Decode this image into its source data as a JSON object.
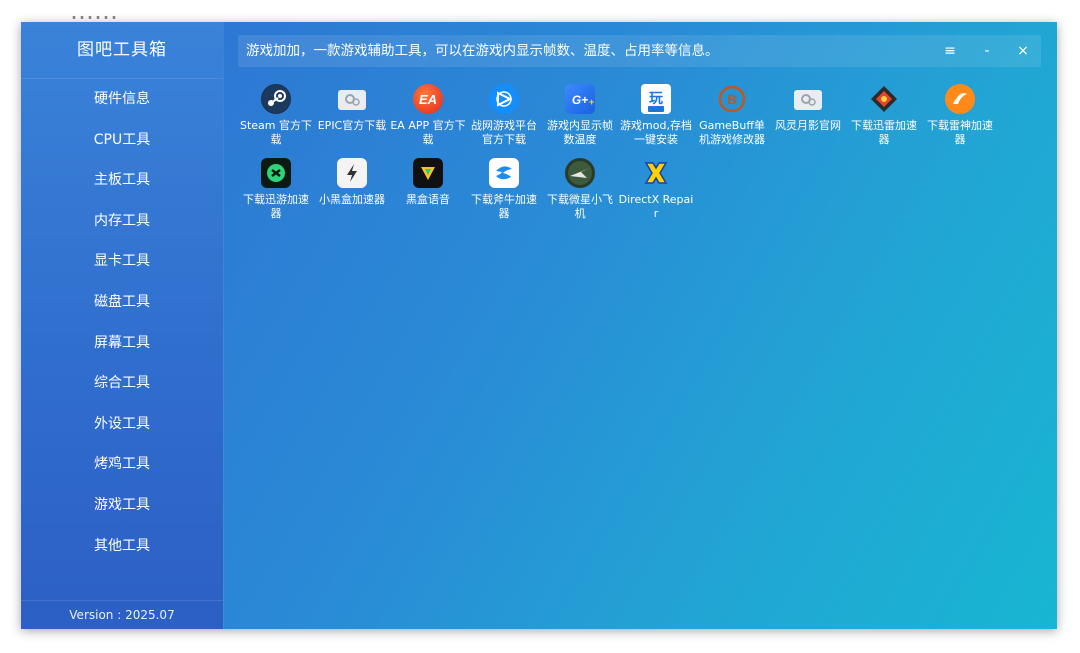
{
  "background_fragment": "……",
  "app": {
    "title": "图吧工具箱",
    "version": "Version : 2025.07",
    "notice": "游戏加加，一款游戏辅助工具，可以在游戏内显示帧数、温度、占用率等信息。"
  },
  "window_controls": {
    "menu": "≡",
    "minimize": "-",
    "close": "×"
  },
  "sidebar": {
    "items": [
      {
        "label": "硬件信息"
      },
      {
        "label": "CPU工具"
      },
      {
        "label": "主板工具"
      },
      {
        "label": "内存工具"
      },
      {
        "label": "显卡工具"
      },
      {
        "label": "磁盘工具"
      },
      {
        "label": "屏幕工具"
      },
      {
        "label": "综合工具"
      },
      {
        "label": "外设工具"
      },
      {
        "label": "烤鸡工具"
      },
      {
        "label": "游戏工具"
      },
      {
        "label": "其他工具"
      }
    ]
  },
  "tools": [
    {
      "label": "Steam 官方下载",
      "icon": "steam-icon"
    },
    {
      "label": "EPIC官方下载",
      "icon": "placeholder-gear-icon"
    },
    {
      "label": "EA APP 官方下载",
      "icon": "ea-icon"
    },
    {
      "label": "战网游戏平台官方下载",
      "icon": "battlenet-icon"
    },
    {
      "label": "游戏内显示帧数温度",
      "icon": "gplus-icon"
    },
    {
      "label": "游戏mod,存档一键安装",
      "icon": "mod-beta-icon"
    },
    {
      "label": "GameBuff单机游戏修改器",
      "icon": "gamebuff-icon"
    },
    {
      "label": "风灵月影官网",
      "icon": "placeholder-gear-icon"
    },
    {
      "label": "下载迅雷加速器",
      "icon": "xunlei-icon"
    },
    {
      "label": "下载雷神加速器",
      "icon": "leishen-icon"
    },
    {
      "label": "下载迅游加速器",
      "icon": "xunyou-icon"
    },
    {
      "label": "小黑盒加速器",
      "icon": "heybox-icon"
    },
    {
      "label": "黑盒语音",
      "icon": "heybox-voice-icon"
    },
    {
      "label": "下载斧牛加速器",
      "icon": "funiu-icon"
    },
    {
      "label": "下载微星小飞机",
      "icon": "afterburner-icon"
    },
    {
      "label": "DirectX Repair",
      "icon": "directx-repair-icon"
    }
  ],
  "colors": {
    "accent": "#2a8ad6",
    "sidebar": "#2f6ccd",
    "text": "#ffffff"
  }
}
